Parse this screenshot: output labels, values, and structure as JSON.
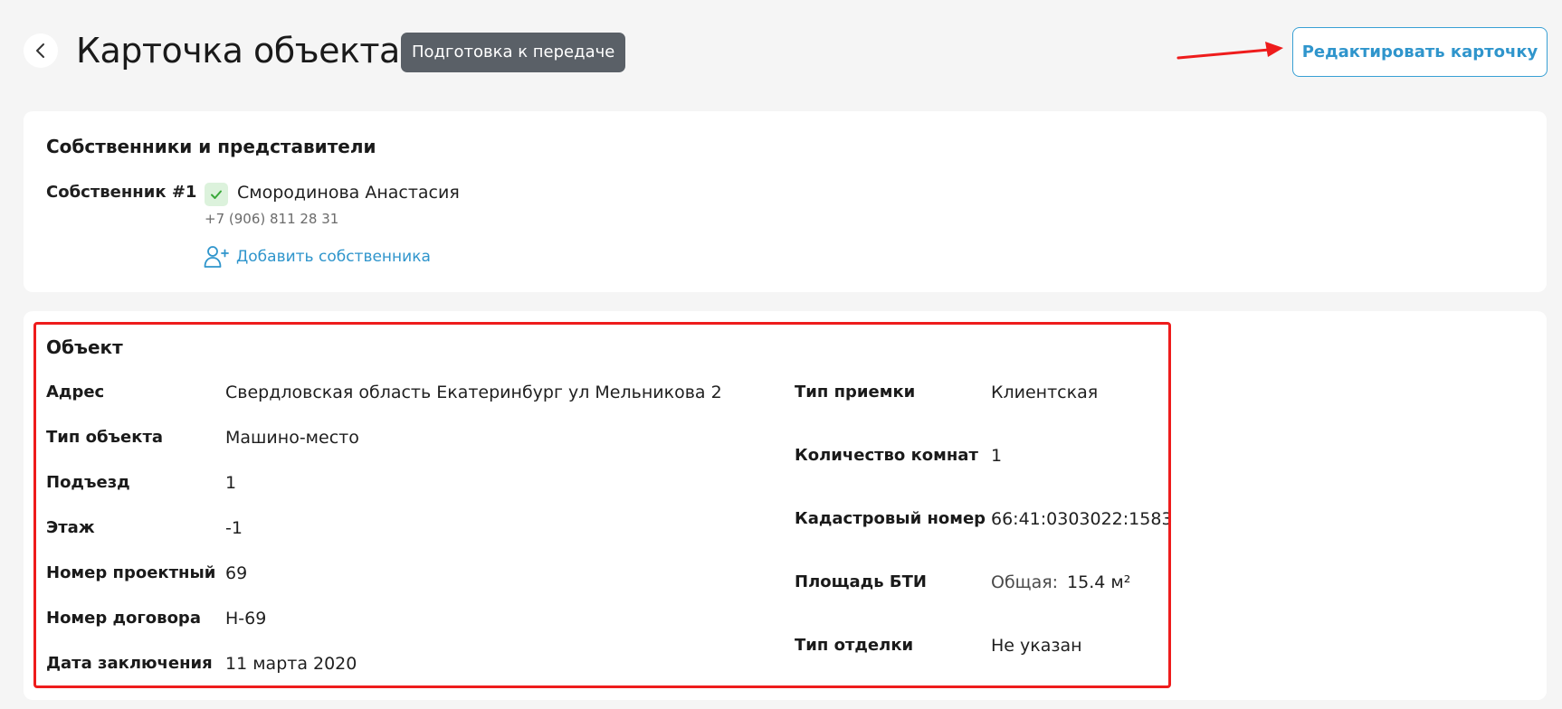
{
  "header": {
    "title": "Карточка объекта",
    "status": "Подготовка к передаче",
    "edit_label": "Редактировать карточку"
  },
  "owners": {
    "title": "Собственники и представители",
    "owner_label": "Собственник #1",
    "owner_name": "Смородинова Анастасия",
    "owner_phone": "+7 (906) 811 28 31",
    "add_label": "Добавить собственника"
  },
  "object": {
    "title": "Объект",
    "left_rows": [
      {
        "label": "Адрес",
        "value": "Свердловская область Екатеринбург ул Мельникова 2"
      },
      {
        "label": "Тип объекта",
        "value": "Машино-место"
      },
      {
        "label": "Подъезд",
        "value": "1"
      },
      {
        "label": "Этаж",
        "value": "-1"
      },
      {
        "label": "Номер проектный",
        "value": "69"
      },
      {
        "label": "Номер договора",
        "value": "Н-69"
      },
      {
        "label": "Дата заключения",
        "value": "11 марта 2020"
      }
    ],
    "right_rows": [
      {
        "label": "Тип приемки",
        "value": "Клиентская"
      },
      {
        "label": "Количество комнат",
        "value": "1"
      },
      {
        "label": "Кадастровый номер",
        "value": "66:41:0303022:1583"
      },
      {
        "label": "Площадь БТИ",
        "prefix": "Общая:",
        "value": "15.4 м²"
      },
      {
        "label": "Тип отделки",
        "value": "Не указан"
      }
    ]
  },
  "icons": {
    "back": "chevron-left-icon",
    "verified": "check-icon",
    "add_owner": "add-user-icon"
  },
  "colors": {
    "accent": "#2f95cc",
    "badge_bg": "#5a6067",
    "verified_bg": "#dcf2dc",
    "verified_check": "#3aa83a",
    "annotation": "#ee1c1c",
    "page_bg": "#f5f5f5"
  }
}
